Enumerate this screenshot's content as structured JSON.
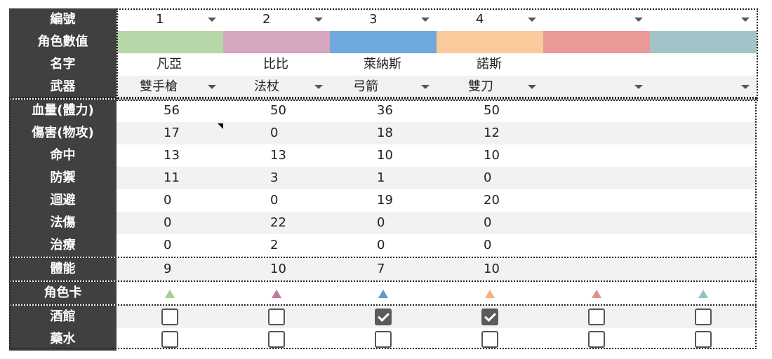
{
  "labels": {
    "number": "編號",
    "stats": "角色數值",
    "name": "名字",
    "weapon": "武器",
    "hp": "血量(體力)",
    "damage": "傷害(物攻)",
    "hit": "命中",
    "defense": "防禦",
    "evasion": "迴避",
    "magic": "法傷",
    "heal": "治療",
    "stamina": "體能",
    "card": "角色卡",
    "tavern": "酒館",
    "potion": "藥水"
  },
  "columns": [
    {
      "number": "1",
      "color": "#b7d7a8",
      "name": "凡亞",
      "weapon": "雙手槍",
      "hp": "56",
      "damage": "17",
      "hit": "13",
      "defense": "11",
      "evasion": "0",
      "magic": "0",
      "heal": "0",
      "stamina": "9",
      "triangle": "#a8d08d",
      "tavern": false,
      "potion": false
    },
    {
      "number": "2",
      "color": "#d5a6bd",
      "name": "比比",
      "weapon": "法杖",
      "hp": "50",
      "damage": "0",
      "hit": "13",
      "defense": "3",
      "evasion": "0",
      "magic": "22",
      "heal": "2",
      "stamina": "10",
      "triangle": "#c27ba0",
      "tavern": false,
      "potion": false
    },
    {
      "number": "3",
      "color": "#6fa8dc",
      "name": "萊納斯",
      "weapon": "弓箭",
      "hp": "36",
      "damage": "18",
      "hit": "10",
      "defense": "1",
      "evasion": "19",
      "magic": "0",
      "heal": "0",
      "stamina": "7",
      "triangle": "#5b9bd5",
      "tavern": true,
      "potion": false
    },
    {
      "number": "4",
      "color": "#f9cb9c",
      "name": "諾斯",
      "weapon": "雙刀",
      "hp": "50",
      "damage": "12",
      "hit": "10",
      "defense": "0",
      "evasion": "20",
      "magic": "0",
      "heal": "0",
      "stamina": "10",
      "triangle": "#f4b183",
      "tavern": true,
      "potion": false
    },
    {
      "number": "",
      "color": "#ea9999",
      "name": "",
      "weapon": "",
      "hp": "",
      "damage": "",
      "hit": "",
      "defense": "",
      "evasion": "",
      "magic": "",
      "heal": "",
      "stamina": "",
      "triangle": "#e48f8f",
      "tavern": false,
      "potion": false
    },
    {
      "number": "",
      "color": "#a2c4c9",
      "name": "",
      "weapon": "",
      "hp": "",
      "damage": "",
      "hit": "",
      "defense": "",
      "evasion": "",
      "magic": "",
      "heal": "",
      "stamina": "",
      "triangle": "#93c1c6",
      "tavern": false,
      "potion": false
    }
  ]
}
